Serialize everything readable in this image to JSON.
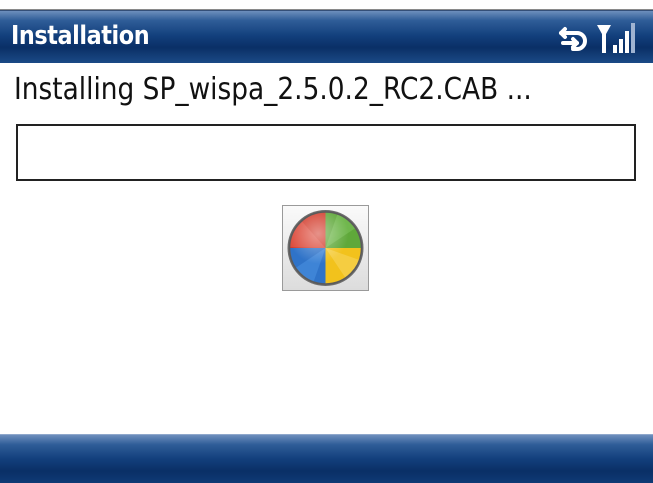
{
  "window": {
    "title": "Installation"
  },
  "status": {
    "data_icon": "data-connection-icon",
    "signal_icon": "signal-strength-icon"
  },
  "message": "Installing SP_wispa_2.5.0.2_RC2.CAB ...",
  "progress": {
    "value_percent": 0
  },
  "logo": {
    "icon": "windows-mobile-logo-icon"
  },
  "colors": {
    "title_bar": "#123f7c",
    "title_text": "#ffffff",
    "background": "#ffffff",
    "logo_red": "#d23a2a",
    "logo_green": "#5fa83a",
    "logo_blue": "#2f73c8",
    "logo_yellow": "#f2c21c"
  }
}
